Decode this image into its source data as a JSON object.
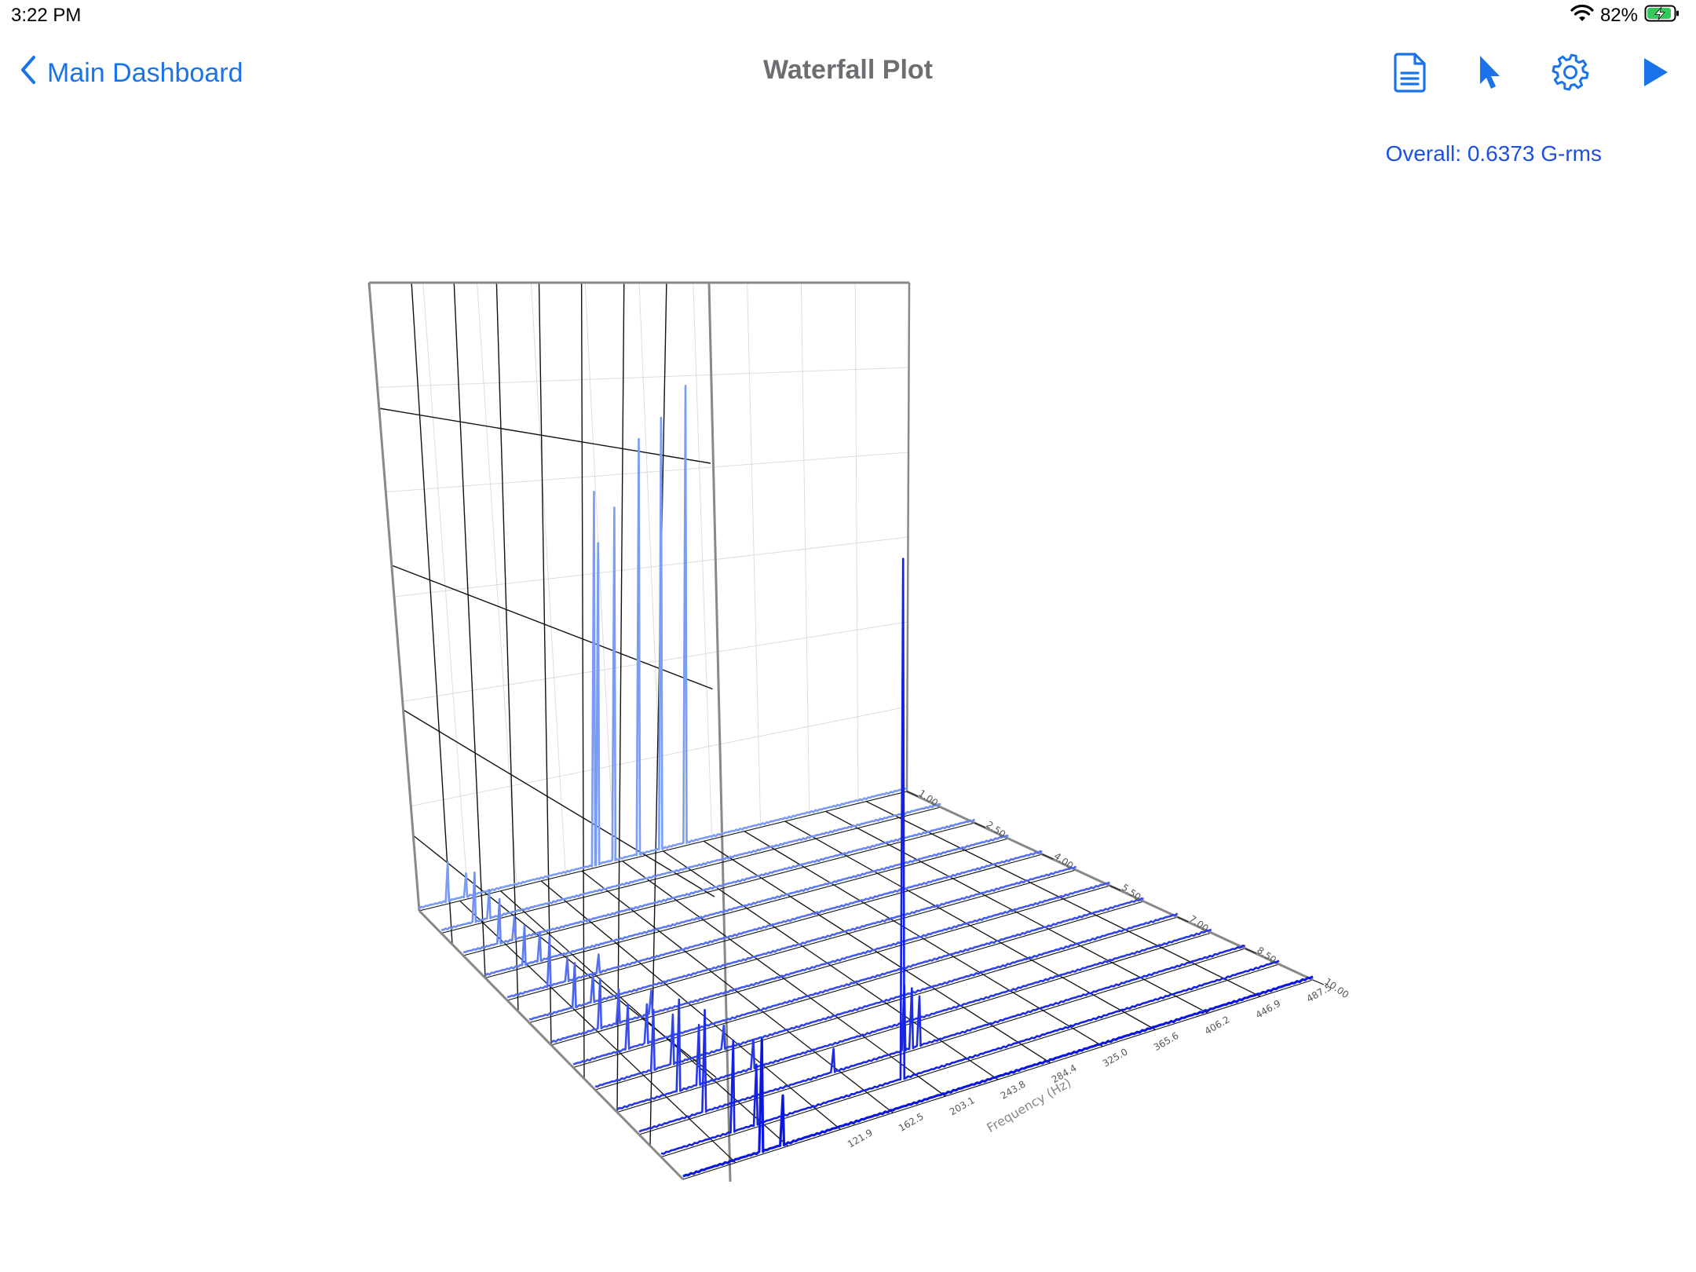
{
  "status_bar": {
    "time": "3:22 PM",
    "battery_percent": "82%",
    "icons": [
      "wifi-icon",
      "battery-charging-icon"
    ]
  },
  "nav": {
    "back_label": "Main Dashboard",
    "title": "Waterfall Plot",
    "accent_color": "#1a73e8",
    "toolbar_icons": [
      "document-icon",
      "cursor-arrow-icon",
      "gear-icon",
      "play-icon"
    ]
  },
  "overall": {
    "text": "Overall: 0.6373 G-rms",
    "color": "#1d4fe0"
  },
  "chart_data": {
    "type": "line",
    "title": "",
    "xlabel": "Frequency (Hz)",
    "ylabel": "",
    "zlabel": "",
    "grid": true,
    "frequency_ticks": [
      "121.9",
      "162.5",
      "203.1",
      "243.8",
      "284.4",
      "325.0",
      "365.6",
      "406.2",
      "446.9",
      "487.5"
    ],
    "time_ticks": [
      "1.00",
      "2.50",
      "4.00",
      "5.50",
      "7.00",
      "8.50",
      "10.00"
    ],
    "xlim": [
      0,
      500
    ],
    "series_colors_back_to_front": [
      "#7a9cf5",
      "#0b16e0"
    ],
    "series": [
      {
        "peaks": [
          [
            30,
            0.08
          ],
          [
            47,
            0.05
          ],
          [
            180,
            0.72
          ],
          [
            184,
            0.62
          ],
          [
            200,
            0.68
          ],
          [
            225,
            0.8
          ],
          [
            248,
            0.83
          ],
          [
            272,
            0.88
          ]
        ]
      },
      {
        "peaks": [
          [
            33,
            0.1
          ],
          [
            48,
            0.06
          ]
        ]
      },
      {
        "peaks": [
          [
            36,
            0.09
          ],
          [
            50,
            0.05
          ]
        ]
      },
      {
        "peaks": [
          [
            38,
            0.08
          ],
          [
            53,
            0.06
          ]
        ]
      },
      {
        "peaks": [
          [
            40,
            0.1
          ],
          [
            56,
            0.05
          ],
          [
            86,
            0.04
          ]
        ]
      },
      {
        "peaks": [
          [
            42,
            0.09
          ],
          [
            58,
            0.06
          ]
        ]
      },
      {
        "peaks": [
          [
            44,
            0.1
          ],
          [
            61,
            0.07
          ],
          [
            90,
            0.05
          ]
        ]
      },
      {
        "peaks": [
          [
            47,
            0.09
          ],
          [
            64,
            0.08
          ]
        ]
      },
      {
        "peaks": [
          [
            50,
            0.12
          ],
          [
            66,
            0.1
          ],
          [
            110,
            0.05
          ]
        ]
      },
      {
        "peaks": [
          [
            52,
            0.18
          ],
          [
            69,
            0.12
          ],
          [
            115,
            0.06
          ]
        ]
      },
      {
        "peaks": [
          [
            55,
            0.2
          ],
          [
            160,
            0.05
          ],
          [
            218,
            0.13
          ],
          [
            225,
            0.12
          ],
          [
            232,
            0.1
          ]
        ]
      },
      {
        "peaks": [
          [
            58,
            0.18
          ],
          [
            78,
            0.12
          ],
          [
            196,
            1.0
          ]
        ]
      },
      {
        "peaks": [
          [
            62,
            0.22
          ],
          [
            80,
            0.1
          ]
        ]
      }
    ]
  }
}
